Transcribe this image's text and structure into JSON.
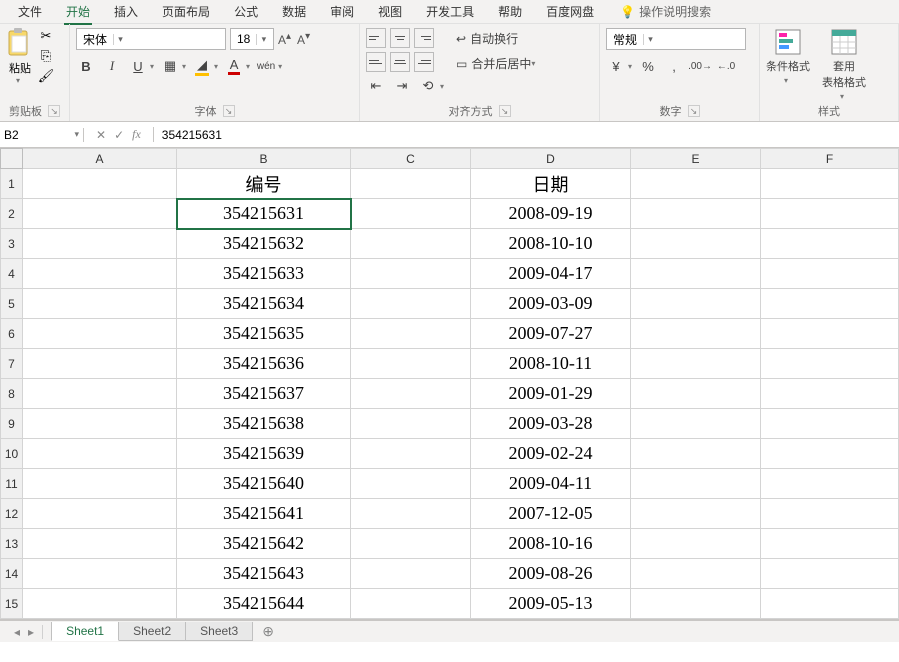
{
  "menu": {
    "file": "文件",
    "items": [
      "开始",
      "插入",
      "页面布局",
      "公式",
      "数据",
      "审阅",
      "视图",
      "开发工具",
      "帮助",
      "百度网盘"
    ],
    "active_index": 0,
    "tell_me": "操作说明搜索"
  },
  "ribbon": {
    "clipboard": {
      "paste": "粘贴",
      "label": "剪贴板"
    },
    "font": {
      "name": "宋体",
      "size": "18",
      "label": "字体"
    },
    "align": {
      "wrap": "自动换行",
      "merge": "合并后居中",
      "label": "对齐方式"
    },
    "number": {
      "format": "常规",
      "label": "数字"
    },
    "styles": {
      "cond": "条件格式",
      "table": "套用\n表格格式",
      "label": "样式"
    }
  },
  "formula_bar": {
    "cell": "B2",
    "value": "354215631"
  },
  "columns": [
    "A",
    "B",
    "C",
    "D",
    "E",
    "F"
  ],
  "headers": {
    "B": "编号",
    "D": "日期"
  },
  "rows": [
    {
      "n": 1,
      "B": "编号",
      "D": "日期"
    },
    {
      "n": 2,
      "B": "354215631",
      "D": "2008-09-19"
    },
    {
      "n": 3,
      "B": "354215632",
      "D": "2008-10-10"
    },
    {
      "n": 4,
      "B": "354215633",
      "D": "2009-04-17"
    },
    {
      "n": 5,
      "B": "354215634",
      "D": "2009-03-09"
    },
    {
      "n": 6,
      "B": "354215635",
      "D": "2009-07-27"
    },
    {
      "n": 7,
      "B": "354215636",
      "D": "2008-10-11"
    },
    {
      "n": 8,
      "B": "354215637",
      "D": "2009-01-29"
    },
    {
      "n": 9,
      "B": "354215638",
      "D": "2009-03-28"
    },
    {
      "n": 10,
      "B": "354215639",
      "D": "2009-02-24"
    },
    {
      "n": 11,
      "B": "354215640",
      "D": "2009-04-11"
    },
    {
      "n": 12,
      "B": "354215641",
      "D": "2007-12-05"
    },
    {
      "n": 13,
      "B": "354215642",
      "D": "2008-10-16"
    },
    {
      "n": 14,
      "B": "354215643",
      "D": "2009-08-26"
    },
    {
      "n": 15,
      "B": "354215644",
      "D": "2009-05-13"
    }
  ],
  "tabs": {
    "items": [
      "Sheet1",
      "Sheet2",
      "Sheet3"
    ],
    "active_index": 0
  }
}
